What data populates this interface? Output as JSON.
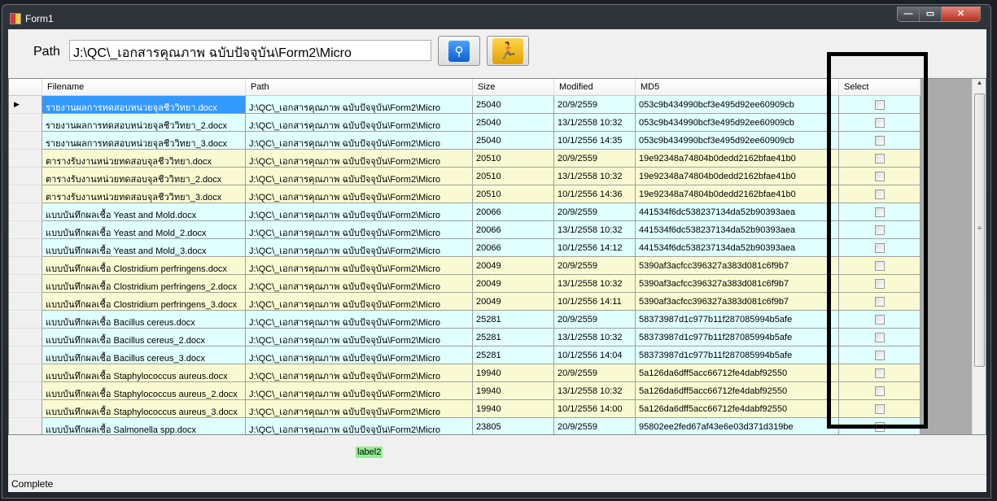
{
  "window": {
    "title": "Form1"
  },
  "toolbar": {
    "path_label": "Path",
    "path_value": "J:\\QC\\_เอกสารคุณภาพ ฉบับปัจจุบัน\\Form2\\Micro",
    "search_icon": "search-icon",
    "run_icon": "running-man-icon"
  },
  "grid": {
    "columns": [
      "Filename",
      "Path",
      "Size",
      "Modified",
      "MD5",
      "Select"
    ],
    "colors": {
      "cyan": "#e0ffff",
      "yellow": "#fafad2",
      "selected": "#3399ff"
    },
    "rows": [
      {
        "filename": "รายงานผลการทดสอบหน่วยจุลชีววิทยา.docx",
        "path": "J:\\QC\\_เอกสารคุณภาพ ฉบับปัจจุบัน\\Form2\\Micro",
        "size": "25040",
        "modified": "20/9/2559",
        "md5": "053c9b434990bcf3e495d92ee60909cb",
        "color": "cyan"
      },
      {
        "filename": "รายงานผลการทดสอบหน่วยจุลชีววิทยา_2.docx",
        "path": "J:\\QC\\_เอกสารคุณภาพ ฉบับปัจจุบัน\\Form2\\Micro",
        "size": "25040",
        "modified": "13/1/2558 10:32",
        "md5": "053c9b434990bcf3e495d92ee60909cb",
        "color": "cyan"
      },
      {
        "filename": "รายงานผลการทดสอบหน่วยจุลชีววิทยา_3.docx",
        "path": "J:\\QC\\_เอกสารคุณภาพ ฉบับปัจจุบัน\\Form2\\Micro",
        "size": "25040",
        "modified": "10/1/2556 14:35",
        "md5": "053c9b434990bcf3e495d92ee60909cb",
        "color": "cyan"
      },
      {
        "filename": "ตารางรับงานหน่วยทดสอบจุลชีววิทยา.docx",
        "path": "J:\\QC\\_เอกสารคุณภาพ ฉบับปัจจุบัน\\Form2\\Micro",
        "size": "20510",
        "modified": "20/9/2559",
        "md5": "19e92348a74804b0dedd2162bfae41b0",
        "color": "yellow"
      },
      {
        "filename": "ตารางรับงานหน่วยทดสอบจุลชีววิทยา_2.docx",
        "path": "J:\\QC\\_เอกสารคุณภาพ ฉบับปัจจุบัน\\Form2\\Micro",
        "size": "20510",
        "modified": "13/1/2558 10:32",
        "md5": "19e92348a74804b0dedd2162bfae41b0",
        "color": "yellow"
      },
      {
        "filename": "ตารางรับงานหน่วยทดสอบจุลชีววิทยา_3.docx",
        "path": "J:\\QC\\_เอกสารคุณภาพ ฉบับปัจจุบัน\\Form2\\Micro",
        "size": "20510",
        "modified": "10/1/2556 14:36",
        "md5": "19e92348a74804b0dedd2162bfae41b0",
        "color": "yellow"
      },
      {
        "filename": "แบบบันทึกผลเชื้อ Yeast and Mold.docx",
        "path": "J:\\QC\\_เอกสารคุณภาพ ฉบับปัจจุบัน\\Form2\\Micro",
        "size": "20066",
        "modified": "20/9/2559",
        "md5": "441534f6dc538237134da52b90393aea",
        "color": "cyan"
      },
      {
        "filename": "แบบบันทึกผลเชื้อ Yeast and Mold_2.docx",
        "path": "J:\\QC\\_เอกสารคุณภาพ ฉบับปัจจุบัน\\Form2\\Micro",
        "size": "20066",
        "modified": "13/1/2558 10:32",
        "md5": "441534f6dc538237134da52b90393aea",
        "color": "cyan"
      },
      {
        "filename": "แบบบันทึกผลเชื้อ Yeast and Mold_3.docx",
        "path": "J:\\QC\\_เอกสารคุณภาพ ฉบับปัจจุบัน\\Form2\\Micro",
        "size": "20066",
        "modified": "10/1/2556 14:12",
        "md5": "441534f6dc538237134da52b90393aea",
        "color": "cyan"
      },
      {
        "filename": "แบบบันทึกผลเชื้อ Clostridium perfringens.docx",
        "path": "J:\\QC\\_เอกสารคุณภาพ ฉบับปัจจุบัน\\Form2\\Micro",
        "size": "20049",
        "modified": "20/9/2559",
        "md5": "5390af3acfcc396327a383d081c6f9b7",
        "color": "yellow"
      },
      {
        "filename": "แบบบันทึกผลเชื้อ Clostridium perfringens_2.docx",
        "path": "J:\\QC\\_เอกสารคุณภาพ ฉบับปัจจุบัน\\Form2\\Micro",
        "size": "20049",
        "modified": "13/1/2558 10:32",
        "md5": "5390af3acfcc396327a383d081c6f9b7",
        "color": "yellow"
      },
      {
        "filename": "แบบบันทึกผลเชื้อ Clostridium perfringens_3.docx",
        "path": "J:\\QC\\_เอกสารคุณภาพ ฉบับปัจจุบัน\\Form2\\Micro",
        "size": "20049",
        "modified": "10/1/2556 14:11",
        "md5": "5390af3acfcc396327a383d081c6f9b7",
        "color": "yellow"
      },
      {
        "filename": "แบบบันทึกผลเชื้อ Bacillus cereus.docx",
        "path": "J:\\QC\\_เอกสารคุณภาพ ฉบับปัจจุบัน\\Form2\\Micro",
        "size": "25281",
        "modified": "20/9/2559",
        "md5": "58373987d1c977b11f287085994b5afe",
        "color": "cyan"
      },
      {
        "filename": "แบบบันทึกผลเชื้อ Bacillus cereus_2.docx",
        "path": "J:\\QC\\_เอกสารคุณภาพ ฉบับปัจจุบัน\\Form2\\Micro",
        "size": "25281",
        "modified": "13/1/2558 10:32",
        "md5": "58373987d1c977b11f287085994b5afe",
        "color": "cyan"
      },
      {
        "filename": "แบบบันทึกผลเชื้อ Bacillus cereus_3.docx",
        "path": "J:\\QC\\_เอกสารคุณภาพ ฉบับปัจจุบัน\\Form2\\Micro",
        "size": "25281",
        "modified": "10/1/2556 14:04",
        "md5": "58373987d1c977b11f287085994b5afe",
        "color": "cyan"
      },
      {
        "filename": "แบบบันทึกผลเชื้อ Staphylococcus aureus.docx",
        "path": "J:\\QC\\_เอกสารคุณภาพ ฉบับปัจจุบัน\\Form2\\Micro",
        "size": "19940",
        "modified": "20/9/2559",
        "md5": "5a126da6dff5acc66712fe4dabf92550",
        "color": "yellow"
      },
      {
        "filename": "แบบบันทึกผลเชื้อ Staphylococcus aureus_2.docx",
        "path": "J:\\QC\\_เอกสารคุณภาพ ฉบับปัจจุบัน\\Form2\\Micro",
        "size": "19940",
        "modified": "13/1/2558 10:32",
        "md5": "5a126da6dff5acc66712fe4dabf92550",
        "color": "yellow"
      },
      {
        "filename": "แบบบันทึกผลเชื้อ Staphylococcus aureus_3.docx",
        "path": "J:\\QC\\_เอกสารคุณภาพ ฉบับปัจจุบัน\\Form2\\Micro",
        "size": "19940",
        "modified": "10/1/2556 14:00",
        "md5": "5a126da6dff5acc66712fe4dabf92550",
        "color": "yellow"
      },
      {
        "filename": "แบบบันทึกผลเชื้อ Salmonella spp.docx",
        "path": "J:\\QC\\_เอกสารคุณภาพ ฉบับปัจจุบัน\\Form2\\Micro",
        "size": "23805",
        "modified": "20/9/2559",
        "md5": "95802ee2fed67af43e6e03d371d319be",
        "color": "cyan"
      }
    ]
  },
  "label2": "label2",
  "status": "Complete"
}
